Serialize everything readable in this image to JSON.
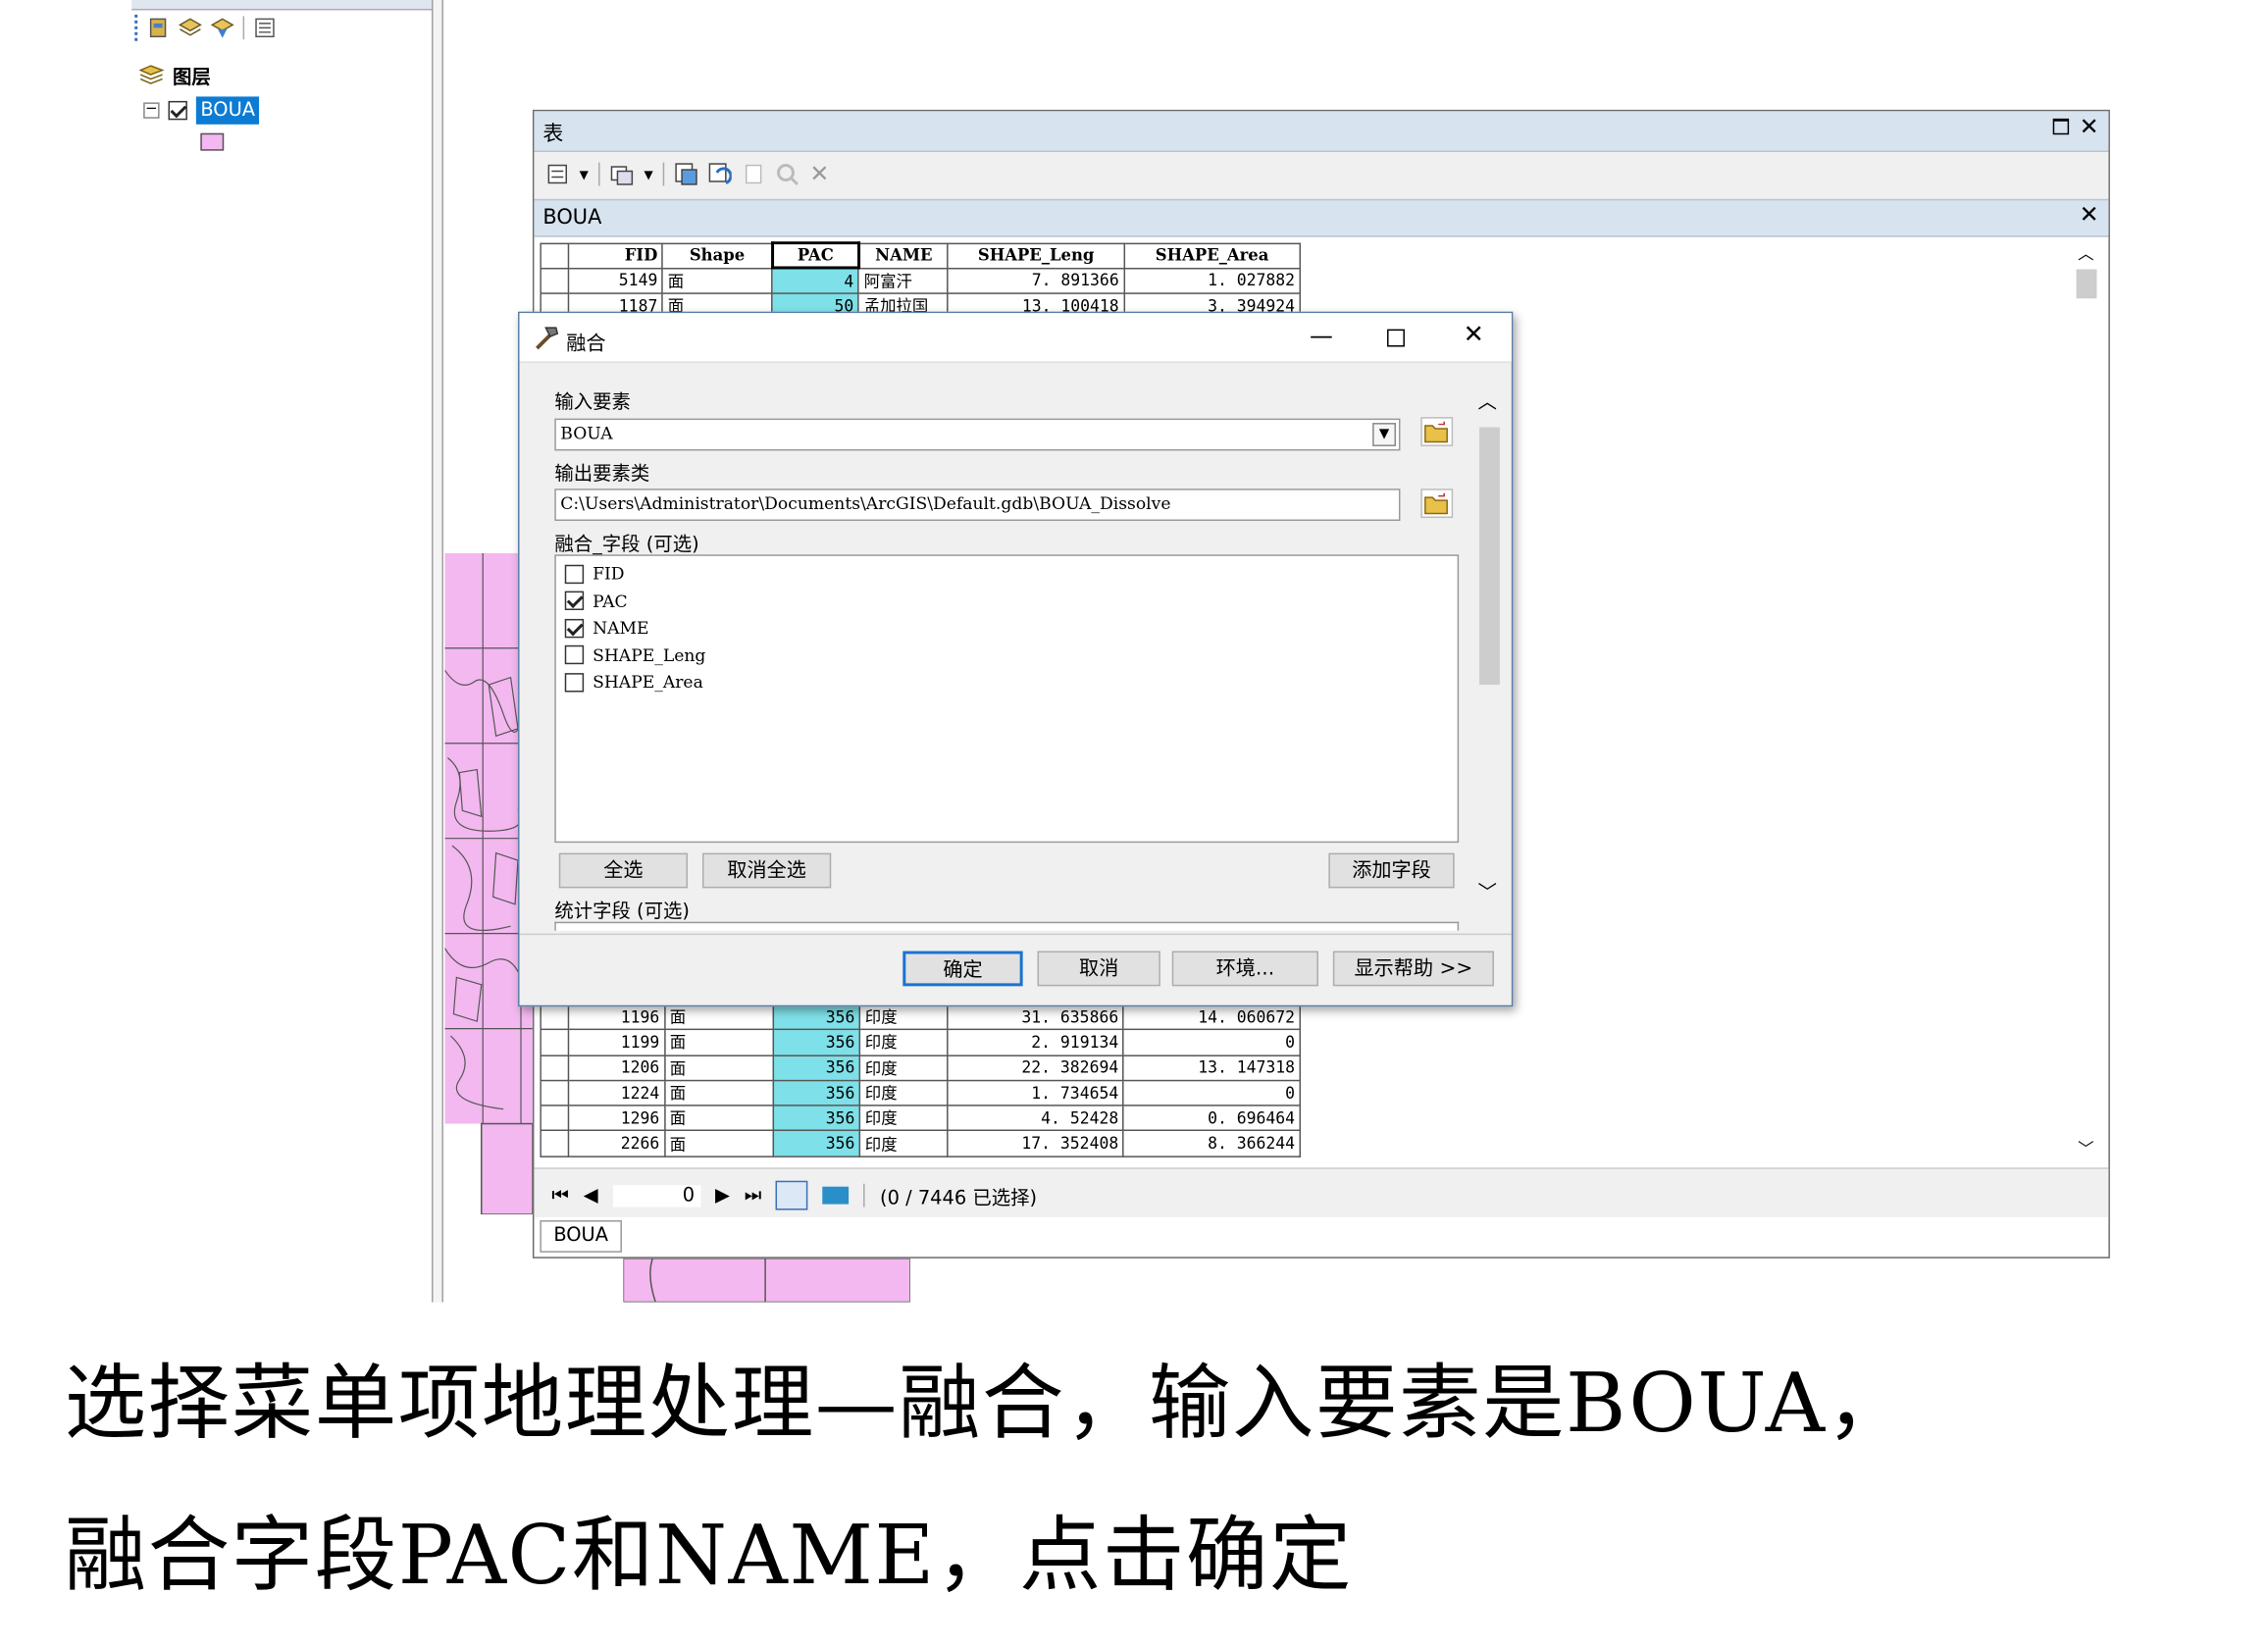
{
  "toc": {
    "layers_label": "图层",
    "layer_name": "BOUA",
    "symbol_color": "#f3b8ef"
  },
  "table_window": {
    "title": "表",
    "tab_name": "BOUA",
    "columns": [
      "FID",
      "Shape",
      "PAC",
      "NAME",
      "SHAPE_Leng",
      "SHAPE_Area"
    ],
    "rows_top": [
      {
        "fid": "5149",
        "shape": "面",
        "pac": "4",
        "name": "阿富汗",
        "leng": "7. 891366",
        "area": "1. 027882"
      },
      {
        "fid": "1187",
        "shape": "面",
        "pac": "50",
        "name": "孟加拉国",
        "leng": "13. 100418",
        "area": "3. 394924"
      }
    ],
    "rows_bottom": [
      {
        "fid": "1196",
        "shape": "面",
        "pac": "356",
        "name": "印度",
        "leng": "31. 635866",
        "area": "14. 060672"
      },
      {
        "fid": "1199",
        "shape": "面",
        "pac": "356",
        "name": "印度",
        "leng": "2. 919134",
        "area": "0"
      },
      {
        "fid": "1206",
        "shape": "面",
        "pac": "356",
        "name": "印度",
        "leng": "22. 382694",
        "area": "13. 147318"
      },
      {
        "fid": "1224",
        "shape": "面",
        "pac": "356",
        "name": "印度",
        "leng": "1. 734654",
        "area": "0"
      },
      {
        "fid": "1296",
        "shape": "面",
        "pac": "356",
        "name": "印度",
        "leng": "4. 52428",
        "area": "0. 696464"
      },
      {
        "fid": "2266",
        "shape": "面",
        "pac": "356",
        "name": "印度",
        "leng": "17. 352408",
        "area": "8. 366244"
      }
    ],
    "nav_record": "0",
    "selection_status": "(0 / 7446 已选择)",
    "bottom_tab": "BOUA",
    "pac_color": "#7ee0e8"
  },
  "dialog": {
    "title": "融合",
    "input_label": "输入要素",
    "input_value": "BOUA",
    "output_label": "输出要素类",
    "output_value": "C:\\Users\\Administrator\\Documents\\ArcGIS\\Default.gdb\\BOUA_Dissolve",
    "dissolve_label": "融合_字段 (可选)",
    "fields": [
      {
        "name": "FID",
        "checked": false
      },
      {
        "name": "PAC",
        "checked": true
      },
      {
        "name": "NAME",
        "checked": true
      },
      {
        "name": "SHAPE_Leng",
        "checked": false
      },
      {
        "name": "SHAPE_Area",
        "checked": false
      }
    ],
    "select_all": "全选",
    "unselect_all": "取消全选",
    "add_field": "添加字段",
    "stats_label": "统计字段 (可选)",
    "ok": "确定",
    "cancel": "取消",
    "env": "环境...",
    "help": "显示帮助 >>"
  },
  "caption": {
    "line1": "选择菜单项地理处理—融合，输入要素是BOUA，",
    "line2": "融合字段PAC和NAME，点击确定"
  }
}
